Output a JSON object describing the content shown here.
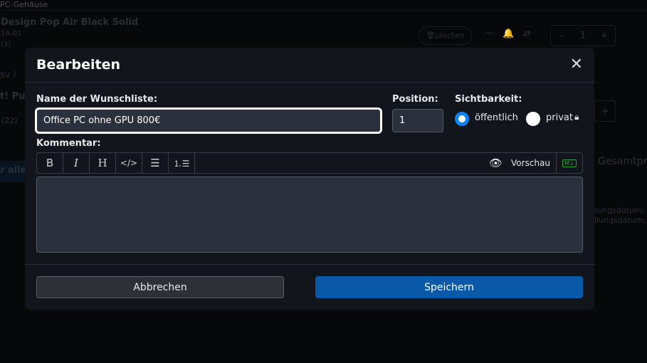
{
  "background": {
    "category": "PC-Gehäuse",
    "product_title": "Design Pop Air Black Solid",
    "sku": "1A-01",
    "count": "(3)",
    "delete_label": "Löschen",
    "qty": "1",
    "minus": "-",
    "plus": "+",
    "breadcrumb": "sv /",
    "title2": "t! Pu",
    "count2": "(22)",
    "all_button": "r alle",
    "total_label": "Gesamtpr",
    "date1": "rungsdatum:",
    "date2": "llungsdatum:"
  },
  "modal": {
    "title": "Bearbeiten",
    "name_label": "Name der Wunschliste:",
    "name_value": "Office PC ohne GPU 800€",
    "position_label": "Position:",
    "position_value": "1",
    "visibility_label": "Sichtbarkeit:",
    "public_label": "öffentlich",
    "private_label": "privat",
    "comment_label": "Kommentar:",
    "preview_label": "Vorschau",
    "markdown_badge": "M↓",
    "cancel_label": "Abbrechen",
    "save_label": "Speichern",
    "visibility_selected": "öffentlich"
  },
  "colors": {
    "accent": "#0d80f2",
    "save": "#0a58a8"
  }
}
